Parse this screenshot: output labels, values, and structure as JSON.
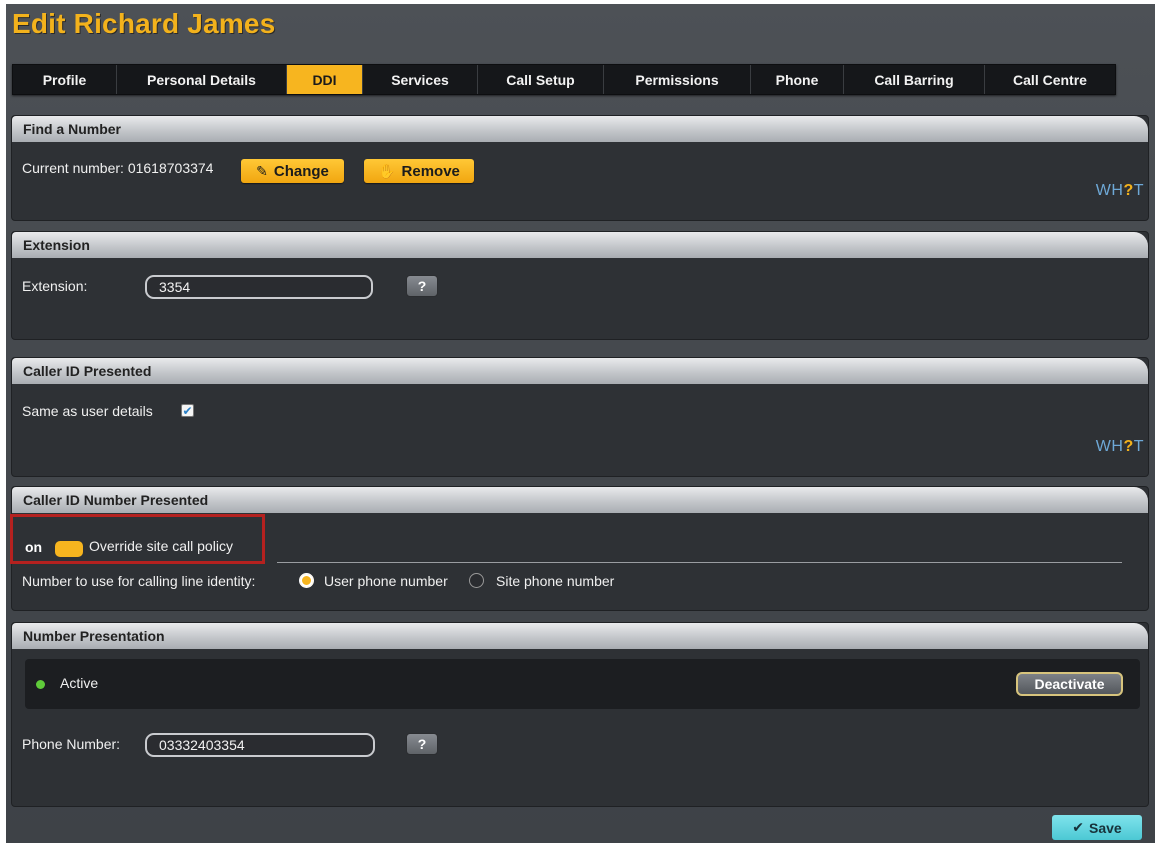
{
  "page_title": "Edit Richard James",
  "tabs": [
    {
      "label": "Profile"
    },
    {
      "label": "Personal Details"
    },
    {
      "label": "DDI"
    },
    {
      "label": "Services"
    },
    {
      "label": "Call Setup"
    },
    {
      "label": "Permissions"
    },
    {
      "label": "Phone"
    },
    {
      "label": "Call Barring"
    },
    {
      "label": "Call Centre"
    }
  ],
  "active_tab": "DDI",
  "find_number": {
    "heading": "Find a Number",
    "current_label": "Current number: 01618703374",
    "change_label": "Change",
    "remove_label": "Remove",
    "what_prefix": "WH",
    "what_q": "?",
    "what_suffix": "T"
  },
  "extension": {
    "heading": "Extension",
    "label": "Extension:",
    "value": "3354",
    "help": "?"
  },
  "caller_id": {
    "heading": "Caller ID Presented",
    "same_label": "Same as user details",
    "same_checked": true,
    "what_prefix": "WH",
    "what_q": "?",
    "what_suffix": "T"
  },
  "caller_id_number": {
    "heading": "Caller ID Number Presented",
    "toggle_state": "on",
    "override_label": "Override site call policy",
    "cli_label": "Number to use for calling line identity:",
    "user_option": "User phone number",
    "site_option": "Site phone number",
    "selected": "user"
  },
  "number_presentation": {
    "heading": "Number Presentation",
    "status": "Active",
    "deactivate_label": "Deactivate",
    "phone_label": "Phone Number:",
    "phone_value": "03332403354",
    "help": "?"
  },
  "save_label": "Save",
  "colors": {
    "accent": "#f7b51f",
    "active_dot": "#5fcb3a",
    "highlight_border": "#b5211f",
    "save": "#4cc8d4"
  }
}
